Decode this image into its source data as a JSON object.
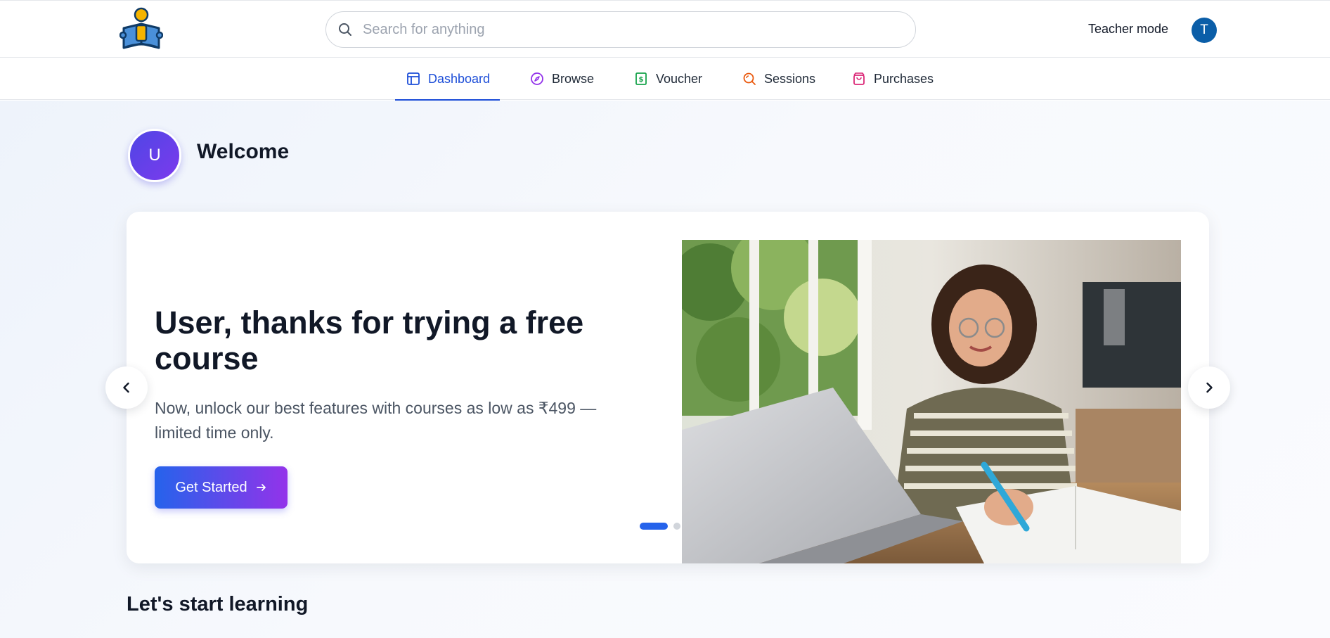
{
  "header": {
    "logo": "reading-person-logo",
    "search_placeholder": "Search for anything",
    "teacher_mode": "Teacher mode",
    "avatar_initial": "T",
    "avatar_color": "#0b5ea8"
  },
  "nav": {
    "tabs": [
      {
        "label": "Dashboard",
        "icon": "dashboard-icon",
        "color": "#1d4ed8",
        "active": true
      },
      {
        "label": "Browse",
        "icon": "compass-icon",
        "color": "#9333ea",
        "active": false
      },
      {
        "label": "Voucher",
        "icon": "voucher-icon",
        "color": "#16a34a",
        "active": false
      },
      {
        "label": "Sessions",
        "icon": "search-sessions-icon",
        "color": "#ea580c",
        "active": false
      },
      {
        "label": "Purchases",
        "icon": "shopping-bag-icon",
        "color": "#db2777",
        "active": false
      }
    ]
  },
  "welcome": {
    "avatar_initial": "U",
    "title": "Welcome"
  },
  "hero": {
    "title": "User, thanks for trying a free course",
    "subtitle": "Now, unlock our best features with courses as low as ₹499 — limited time only.",
    "cta_label": "Get Started",
    "cta_icon": "arrow-right-icon",
    "slide_count": 3,
    "active_slide": 1
  },
  "carousel": {
    "prev_icon": "chevron-left-icon",
    "next_icon": "chevron-right-icon"
  },
  "section": {
    "title": "Let's start learning"
  },
  "colors": {
    "primary": "#2563eb",
    "accent_gradient_start": "#2563eb",
    "accent_gradient_end": "#9333ea"
  }
}
